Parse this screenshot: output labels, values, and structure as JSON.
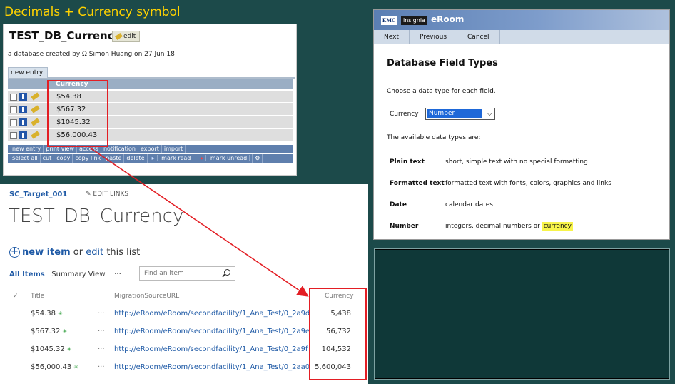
{
  "slide": {
    "title": "Decimals + Currency symbol"
  },
  "eroom_db": {
    "title": "TEST_DB_Currency",
    "edit_label": "edit",
    "created_by": "a database created by Ω Simon Huang on 27 Jun 18",
    "new_entry_tab": "new entry",
    "column_header": "Currency",
    "rows": [
      "$54.38",
      "$567.32",
      "$1045.32",
      "$56,000.43"
    ],
    "toolbar_row1": [
      "new entry",
      "print view",
      "access",
      "notification",
      "export",
      "import"
    ],
    "toolbar_row2": [
      "select all",
      "cut",
      "copy",
      "copy link",
      "paste",
      "delete",
      "mark read",
      "mark unread",
      "⚙"
    ]
  },
  "eroom_dialog": {
    "brand_emc": "EMC",
    "brand_insignia": "insignia",
    "brand_eroom": "eRoom",
    "nav": [
      "Next",
      "Previous",
      "Cancel"
    ],
    "title": "Database Field Types",
    "instruction": "Choose a data type for each field.",
    "field_label": "Currency",
    "field_value": "Number",
    "available_label": "The available data types are:",
    "types": [
      {
        "name": "Plain text",
        "desc": "short, simple text with no special formatting"
      },
      {
        "name": "Formatted text",
        "desc": "formatted text with fonts, colors, graphics and links"
      },
      {
        "name": "Date",
        "desc": "calendar dates"
      },
      {
        "name": "Number",
        "desc": "integers, decimal numbers or ",
        "highlight": "currency"
      }
    ],
    "highlight_color": "#f8f44a"
  },
  "sharepoint": {
    "site_name": "SC_Target_001",
    "edit_links": "EDIT LINKS",
    "list_title": "TEST_DB_Currency",
    "new_item": "new item",
    "or_text": " or ",
    "edit_text": "edit",
    "this_list": " this list",
    "views": [
      "All Items",
      "Summary View",
      "···"
    ],
    "search_placeholder": "Find an item",
    "headers": {
      "check": "✓",
      "title": "Title",
      "url": "MigrationSourceURL",
      "currency": "Currency"
    },
    "rows": [
      {
        "title": "$54.38",
        "url": "http://eRoom/eRoom/secondfacility/1_Ana_Test/0_2a9d",
        "currency": "5,438"
      },
      {
        "title": "$567.32",
        "url": "http://eRoom/eRoom/secondfacility/1_Ana_Test/0_2a9e",
        "currency": "56,732"
      },
      {
        "title": "$1045.32",
        "url": "http://eRoom/eRoom/secondfacility/1_Ana_Test/0_2a9f",
        "currency": "104,532"
      },
      {
        "title": "$56,000.43",
        "url": "http://eRoom/eRoom/secondfacility/1_Ana_Test/0_2aa0",
        "currency": "5,600,043"
      }
    ],
    "new_badge": "✳",
    "row_dots": "···"
  },
  "colors": {
    "slide_bg": "#1c4a4a",
    "title_yellow": "#ffd200",
    "highlight_red": "#e31e24",
    "sharepoint_blue": "#1f5aa6"
  }
}
